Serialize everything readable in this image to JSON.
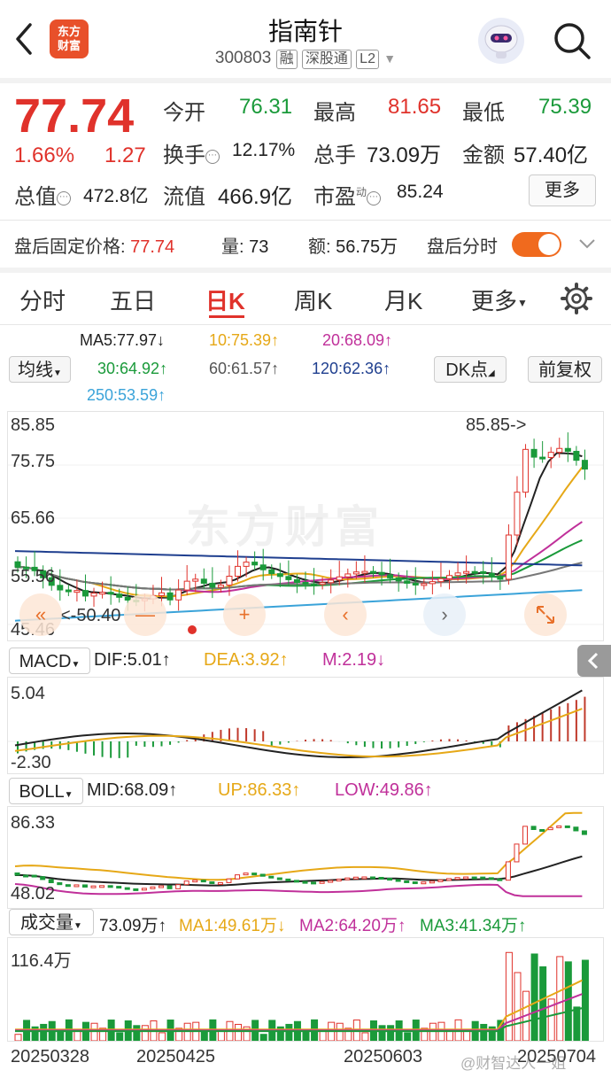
{
  "header": {
    "back_icon": "chevron-left-icon",
    "logo_text_1": "东方",
    "logo_text_2": "财富",
    "title": "指南针",
    "code": "300803",
    "tags": [
      "融",
      "深股通",
      "L2"
    ],
    "avatar_icon": "robot-avatar-icon",
    "search_icon": "search-icon"
  },
  "quote": {
    "price": "77.74",
    "change_pct": "1.66%",
    "change": "1.27",
    "open_label": "今开",
    "open": "76.31",
    "high_label": "最高",
    "high": "81.65",
    "low_label": "最低",
    "low": "75.39",
    "turnover_label": "换手",
    "turnover": "12.17%",
    "volume_label": "总手",
    "volume": "73.09万",
    "amount_label": "金额",
    "amount": "57.40亿",
    "mktcap_label": "总值",
    "mktcap": "472.8亿",
    "float_label": "流值",
    "float": "466.9亿",
    "pe_label": "市盈",
    "pe_sup": "动",
    "pe": "85.24",
    "more_label": "更多"
  },
  "afterhours": {
    "price_label": "盘后固定价格:",
    "price": "77.74",
    "vol_label": "量:",
    "vol": "73",
    "amt_label": "额:",
    "amt": "56.75万",
    "toggle_label": "盘后分时",
    "toggle_on": true
  },
  "tabs": [
    "分时",
    "五日",
    "日K",
    "周K",
    "月K",
    "更多"
  ],
  "active_tab": "日K",
  "ma_panel": {
    "select_label": "均线",
    "ma5": "MA5:77.97↓",
    "ma10": "10:75.39↑",
    "ma20": "20:68.09↑",
    "ma30": "30:64.92↑",
    "ma60": "60:61.57↑",
    "ma120": "120:62.36↑",
    "ma250": "250:53.59↑",
    "dk_label": "DK点",
    "fq_label": "前复权",
    "colors": {
      "ma5": "#222222",
      "ma10": "#e6a817",
      "ma20": "#c0309a",
      "ma30": "#1a9a3a",
      "ma60": "#555555",
      "ma120": "#1f3f8f",
      "ma250": "#3aa3d9"
    }
  },
  "main_chart": {
    "y_labels": [
      "85.85",
      "75.75",
      "65.66",
      "55.56",
      "45.46"
    ],
    "max_annotation": "85.85->",
    "min_annotation": "<-50.40",
    "watermark": "东方财富"
  },
  "macd": {
    "select_label": "MACD",
    "dif": "DIF:5.01↑",
    "dea": "DEA:3.92↑",
    "m": "M:2.19↓",
    "y_labels": [
      "5.04",
      "-2.30"
    ]
  },
  "boll": {
    "select_label": "BOLL",
    "mid": "MID:68.09↑",
    "up": "UP:86.33↑",
    "low": "LOW:49.86↑",
    "y_labels": [
      "86.33",
      "48.02"
    ]
  },
  "volume": {
    "select_label": "成交量",
    "vol": "73.09万↑",
    "ma1": "MA1:49.61万↓",
    "ma2": "MA2:64.20万↑",
    "ma3": "MA3:41.34万↑",
    "y_label": "116.4万"
  },
  "x_dates": [
    "20250328",
    "20250425",
    "20250603",
    "20250704"
  ],
  "footer_watermark": "@财智达人一姐"
}
